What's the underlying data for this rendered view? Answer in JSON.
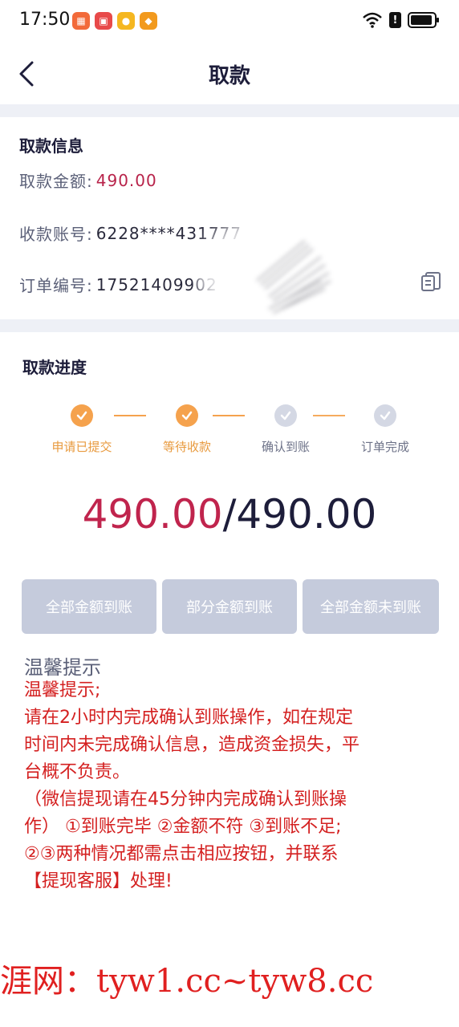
{
  "status_bar": {
    "time": "17:50"
  },
  "nav": {
    "title": "取款"
  },
  "withdraw_info": {
    "section_title": "取款信息",
    "amount_label": "取款金额:",
    "amount_value": "490.00",
    "account_label": "收款账号:",
    "account_value": "6228****431777",
    "order_label": "订单编号:",
    "order_value": "17521409902"
  },
  "progress": {
    "section_title": "取款进度",
    "steps": [
      {
        "label": "申请已提交",
        "status": "done"
      },
      {
        "label": "等待收款",
        "status": "done"
      },
      {
        "label": "确认到账",
        "status": "pending"
      },
      {
        "label": "订单完成",
        "status": "pending"
      }
    ],
    "received": "490.00",
    "separator": "/",
    "total": "490.00"
  },
  "actions": {
    "full_label": "全部金额到账",
    "partial_label": "部分金额到账",
    "none_label": "全部金额未到账"
  },
  "tips": {
    "heading": "温馨提示",
    "lines": [
      "温馨提示;",
      "请在2小时内完成确认到账操作，如在规定",
      "时间内未完成确认信息，造成资金损失，平",
      "台概不负责。",
      "（微信提现请在45分钟内完成确认到账操",
      "作） ①到账完毕 ②金额不符 ③到账不足;",
      "②③两种情况都需点击相应按钮，并联系",
      "【提现客服】处理!"
    ]
  },
  "watermark": {
    "text": "涯网：tyw1.cc~tyw8.cc"
  },
  "colors": {
    "accent_red": "#c0244d",
    "step_done": "#f5a24d",
    "button_disabled": "#c5cbdc",
    "tip_red": "#d42020"
  }
}
